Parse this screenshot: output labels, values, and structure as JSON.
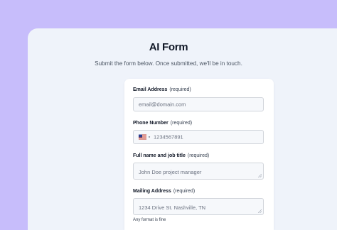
{
  "form": {
    "title": "AI Form",
    "subtitle": "Submit the form below. Once submitted, we'll be in touch.",
    "required_text": "(required)",
    "fields": {
      "email": {
        "label": "Email Address",
        "placeholder": "email@domain.com"
      },
      "phone": {
        "label": "Phone Number",
        "placeholder": "1234567891",
        "flag_icon": "us-flag-icon"
      },
      "name_title": {
        "label": "Full name and job title",
        "placeholder": "John Doe project manager"
      },
      "address": {
        "label": "Mailing Address",
        "placeholder": "1234 Drive St. Nashville, TN",
        "help": "Any format is fine"
      }
    }
  },
  "colors": {
    "background": "#c7bdfb",
    "panel": "#eff3fa",
    "card": "#ffffff",
    "input_bg": "#f6f8fb",
    "input_border": "#d1d5db"
  }
}
